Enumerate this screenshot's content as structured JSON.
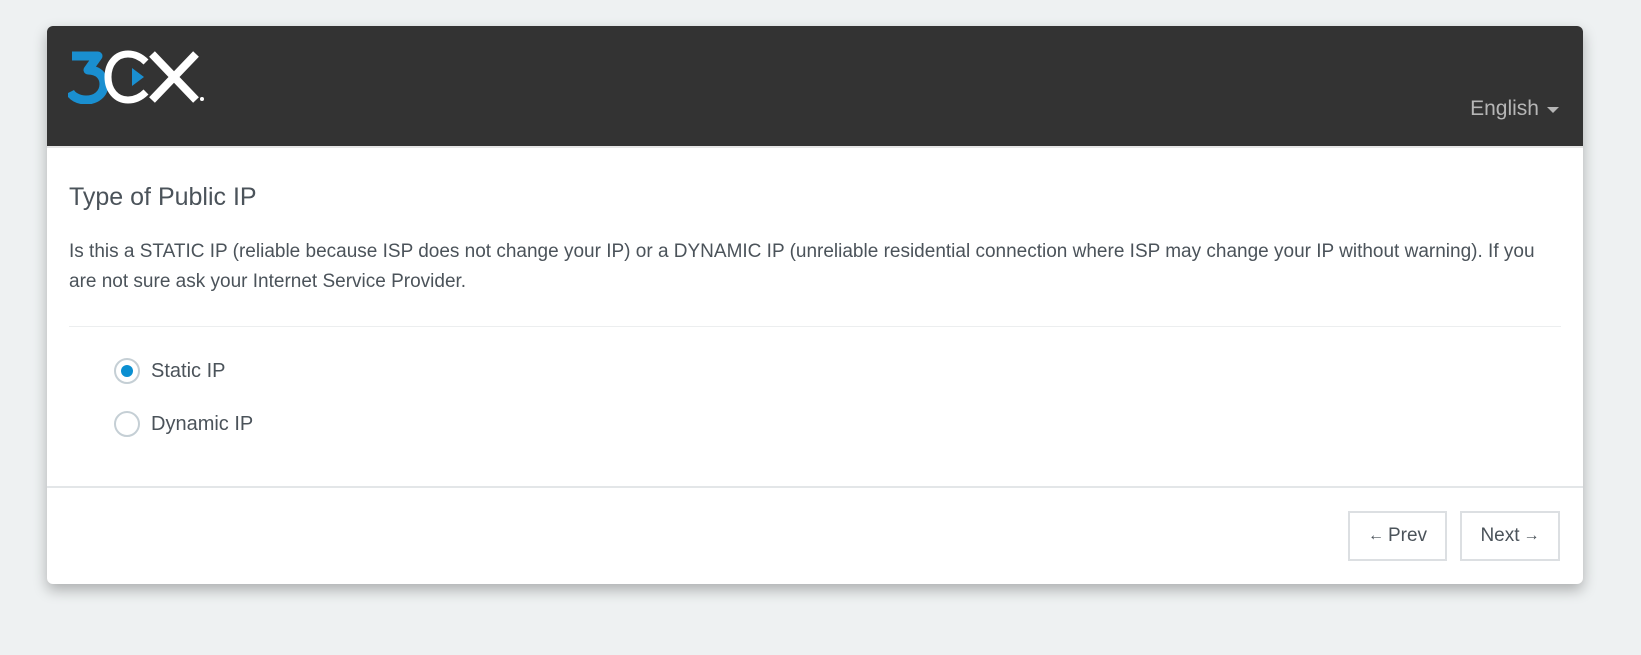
{
  "header": {
    "language_label": "English",
    "icons": {
      "language_caret": "caret-down-icon",
      "logo": "3cx-logo"
    },
    "brand_colors": {
      "blue": "#1a8fd0",
      "white": "#ffffff",
      "header_bg": "#333333"
    }
  },
  "section": {
    "title": "Type of Public IP",
    "description": "Is this a STATIC IP (reliable because ISP does not change your IP) or a DYNAMIC IP (unreliable residential connection where ISP may change your IP without warning). If you are not sure ask your Internet Service Provider."
  },
  "ip_type": {
    "options": [
      {
        "label": "Static IP",
        "selected": true
      },
      {
        "label": "Dynamic IP",
        "selected": false
      }
    ],
    "accent_color": "#0b8fd1"
  },
  "footer": {
    "prev_label": "Prev",
    "next_label": "Next",
    "prev_arrow": "←",
    "next_arrow": "→"
  }
}
